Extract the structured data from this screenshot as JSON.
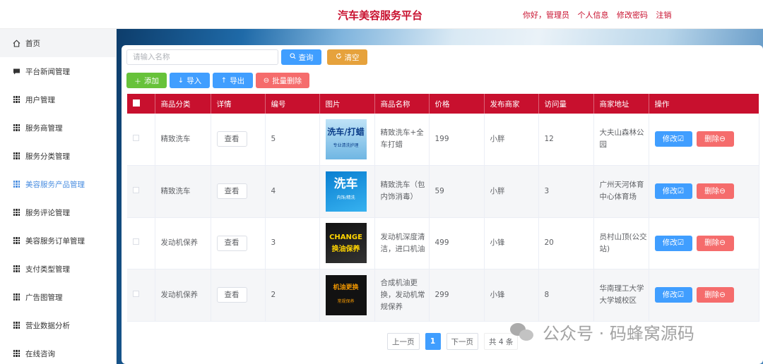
{
  "header": {
    "title": "汽车美容服务平台",
    "greeting": "你好，管理员",
    "profile_link": "个人信息",
    "password_link": "修改密码",
    "logout_link": "注销"
  },
  "sidebar": {
    "items": [
      {
        "label": "首页"
      },
      {
        "label": "平台新闻管理"
      },
      {
        "label": "用户管理"
      },
      {
        "label": "服务商管理"
      },
      {
        "label": "服务分类管理"
      },
      {
        "label": "美容服务产品管理"
      },
      {
        "label": "服务评论管理"
      },
      {
        "label": "美容服务订单管理"
      },
      {
        "label": "支付类型管理"
      },
      {
        "label": "广告图管理"
      },
      {
        "label": "营业数据分析"
      },
      {
        "label": "在线咨询"
      }
    ]
  },
  "toolbar": {
    "search_placeholder": "请输入名称",
    "query_label": "查询",
    "clear_label": "清空",
    "add_label": "添加",
    "import_label": "导入",
    "export_label": "导出",
    "batch_delete_label": "批量删除"
  },
  "table": {
    "columns": [
      "商品分类",
      "详情",
      "编号",
      "图片",
      "商品名称",
      "价格",
      "发布商家",
      "访问量",
      "商家地址",
      "操作"
    ],
    "rows": [
      {
        "category": "精致洗车",
        "detail": "查看",
        "id": "5",
        "image_text": "洗车/打蜡",
        "image_sub": "专业清洗护理",
        "name": "精致洗车+全车打蜡",
        "price": "199",
        "merchant": "小胖",
        "visits": "12",
        "address": "大夫山森林公园",
        "edit": "修改",
        "delete": "删除"
      },
      {
        "category": "精致洗车",
        "detail": "查看",
        "id": "4",
        "image_text": "洗车",
        "image_sub": "内饰/精洗",
        "name": "精致洗车（包内饰消毒）",
        "price": "59",
        "merchant": "小胖",
        "visits": "3",
        "address": "广州天河体育中心体育场",
        "edit": "修改",
        "delete": "删除"
      },
      {
        "category": "发动机保养",
        "detail": "查看",
        "id": "3",
        "image_text": "CHANGE 换油保养",
        "image_sub": "",
        "name": "发动机深度清洁，进口机油",
        "price": "499",
        "merchant": "小锋",
        "visits": "20",
        "address": "员村山顶(公交站)",
        "edit": "修改",
        "delete": "删除"
      },
      {
        "category": "发动机保养",
        "detail": "查看",
        "id": "2",
        "image_text": "机油更换",
        "image_sub": "常规保养",
        "name": "合成机油更换，发动机常规保养",
        "price": "299",
        "merchant": "小锋",
        "visits": "8",
        "address": "华南理工大学大学城校区",
        "edit": "修改",
        "delete": "删除"
      }
    ]
  },
  "pagination": {
    "prev": "上一页",
    "current": "1",
    "next": "下一页",
    "total": "共 4 条"
  },
  "watermark": {
    "text": "公众号 · 码蜂窝源码"
  },
  "colors": {
    "brand": "#c8102e",
    "primary": "#409eff",
    "warning": "#e6a23c",
    "success": "#67c23a",
    "danger": "#f56c6c"
  }
}
